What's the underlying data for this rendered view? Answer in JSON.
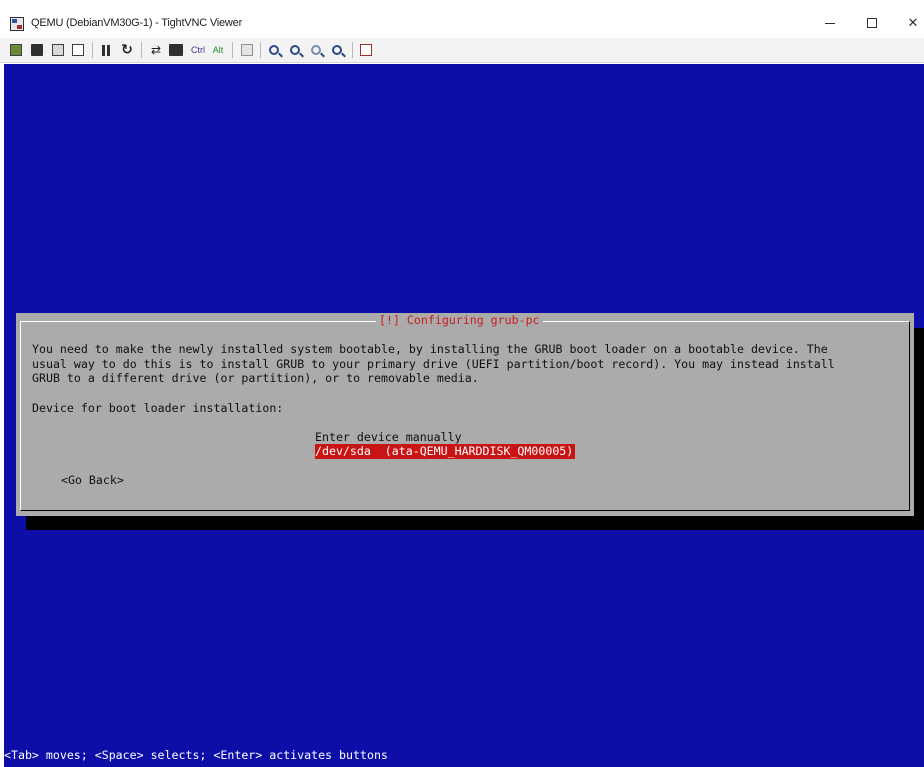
{
  "window": {
    "title": "QEMU (DebianVM30G-1) - TightVNC Viewer",
    "controls": {
      "minimize": "–",
      "maximize": "□",
      "close": "✕"
    }
  },
  "toolbar": {
    "ctrl_label": "Ctrl",
    "alt_label": "Alt",
    "icons": [
      "new-connection-icon",
      "save-icon",
      "options-icon",
      "info-icon",
      "pause-icon",
      "refresh-icon",
      "transfer-icon",
      "ctrl-alt-del-icon",
      "ctrl-key",
      "alt-key",
      "clipboard-icon",
      "zoom-in-icon",
      "zoom-out-icon",
      "zoom-100-icon",
      "zoom-fit-icon",
      "fullscreen-icon"
    ]
  },
  "screen": {
    "background": "#0d0ea8",
    "dialog": {
      "title": "[!] Configuring grub-pc",
      "body_lines": [
        "You need to make the newly installed system bootable, by installing the GRUB boot loader on a bootable device. The",
        "usual way to do this is to install GRUB to your primary drive (UEFI partition/boot record). You may instead install",
        "GRUB to a different drive (or partition), or to removable media."
      ],
      "prompt": "Device for boot loader installation:",
      "options": [
        "Enter device manually",
        "/dev/sda  (ata-QEMU_HARDDISK_QM00005)"
      ],
      "selected_index": 1,
      "go_back": "<Go Back>"
    },
    "help_line": "<Tab> moves; <Space> selects; <Enter> activates buttons",
    "colors": {
      "dialog_bg": "#ababab",
      "title": "#c81e1e",
      "highlight": "#c81414"
    }
  }
}
